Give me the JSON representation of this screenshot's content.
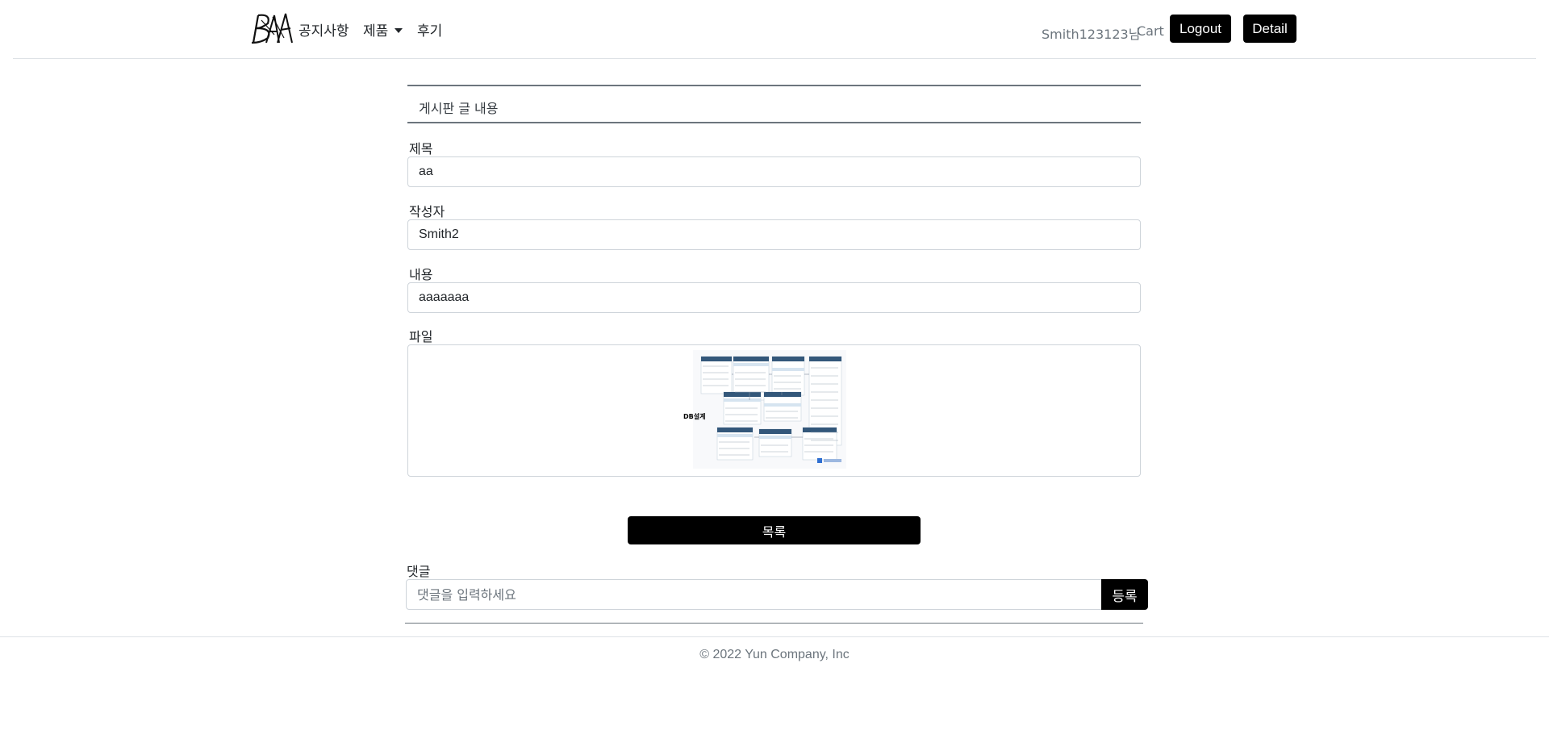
{
  "header": {
    "nav": {
      "notice": "공지사항",
      "product": "제품",
      "review": "후기"
    },
    "user_greeting": "Smith123123님",
    "cart": "Cart",
    "logout": "Logout",
    "detail": "Detail"
  },
  "board": {
    "heading": "게시판 글 내용",
    "title_label": "제목",
    "title_value": "aa",
    "writer_label": "작성자",
    "writer_value": "Smith2",
    "content_label": "내용",
    "content_value": "aaaaaaa",
    "file_label": "파일",
    "file_image_caption": "DB설계",
    "list_button": "목록"
  },
  "comment": {
    "label": "댓글",
    "placeholder": "댓글을 입력하세요",
    "submit": "등록"
  },
  "footer": {
    "copyright": "© 2022 Yun Company, Inc"
  }
}
